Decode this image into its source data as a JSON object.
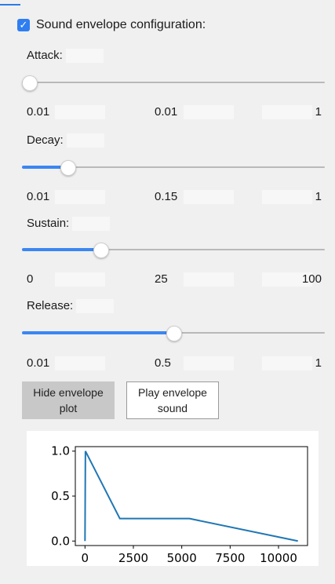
{
  "envelope_toggle": {
    "label": "Sound envelope configuration:",
    "checked": true
  },
  "sliders": [
    {
      "label": "Attack:",
      "min": "0.01",
      "value": "0.01",
      "max": "1",
      "fraction": 0.0
    },
    {
      "label": "Decay:",
      "min": "0.01",
      "value": "0.15",
      "max": "1",
      "fraction": 0.15
    },
    {
      "label": "Sustain:",
      "min": "0",
      "value": "25",
      "max": "100",
      "fraction": 0.26
    },
    {
      "label": "Release:",
      "min": "0.01",
      "value": "0.5",
      "max": "1",
      "fraction": 0.5
    }
  ],
  "buttons": {
    "hide_plot_label": "Hide envelope plot",
    "play_sound_label": "Play envelope sound"
  },
  "colors": {
    "accent": "#2f7ef1",
    "line": "#1f77b4"
  },
  "chart_data": {
    "type": "line",
    "x": [
      0,
      22,
      1800,
      5400,
      11000
    ],
    "y": [
      0,
      1.0,
      0.25,
      0.25,
      0
    ],
    "xticks": [
      "0",
      "2500",
      "5000",
      "7500",
      "10000"
    ],
    "yticks": [
      "0.0",
      "0.5",
      "1.0"
    ],
    "xlim": [
      -500,
      11500
    ],
    "ylim": [
      -0.05,
      1.05
    ],
    "grid": false
  }
}
